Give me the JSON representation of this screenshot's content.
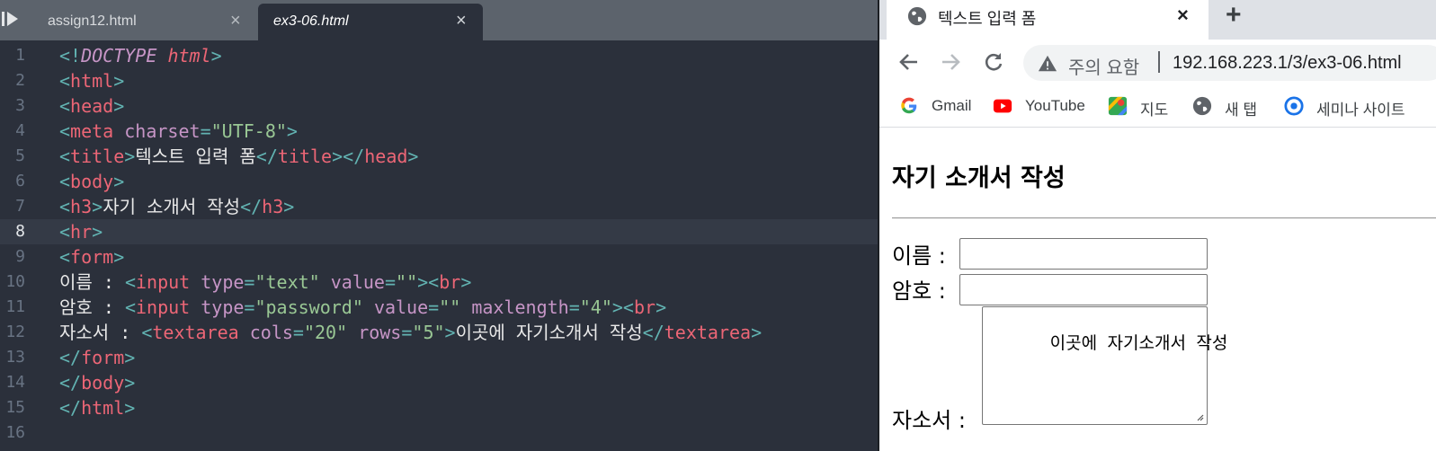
{
  "editor": {
    "tabs": [
      {
        "label": "assign12.html",
        "active": false
      },
      {
        "label": "ex3-06.html",
        "active": true
      }
    ],
    "close_glyph": "×",
    "current_line": 8,
    "line_numbers": [
      "1",
      "2",
      "3",
      "4",
      "5",
      "6",
      "7",
      "8",
      "9",
      "10",
      "11",
      "12",
      "13",
      "14",
      "15",
      "16"
    ],
    "lines": [
      [
        {
          "c": "p",
          "v": "<!"
        },
        {
          "c": "dk",
          "v": "DOCTYPE"
        },
        {
          "c": "tx",
          "v": " "
        },
        {
          "c": "dh",
          "v": "html"
        },
        {
          "c": "p",
          "v": ">"
        }
      ],
      [
        {
          "c": "p",
          "v": "<"
        },
        {
          "c": "t",
          "v": "html"
        },
        {
          "c": "p",
          "v": ">"
        }
      ],
      [
        {
          "c": "p",
          "v": "<"
        },
        {
          "c": "t",
          "v": "head"
        },
        {
          "c": "p",
          "v": ">"
        }
      ],
      [
        {
          "c": "p",
          "v": "<"
        },
        {
          "c": "t",
          "v": "meta"
        },
        {
          "c": "tx",
          "v": " "
        },
        {
          "c": "a",
          "v": "charset"
        },
        {
          "c": "p",
          "v": "="
        },
        {
          "c": "s",
          "v": "\"UTF-8\""
        },
        {
          "c": "p",
          "v": ">"
        }
      ],
      [
        {
          "c": "p",
          "v": "<"
        },
        {
          "c": "t",
          "v": "title"
        },
        {
          "c": "p",
          "v": ">"
        },
        {
          "c": "tx",
          "v": "텍스트 입력 폼"
        },
        {
          "c": "p",
          "v": "</"
        },
        {
          "c": "t",
          "v": "title"
        },
        {
          "c": "p",
          "v": "></"
        },
        {
          "c": "t",
          "v": "head"
        },
        {
          "c": "p",
          "v": ">"
        }
      ],
      [
        {
          "c": "p",
          "v": "<"
        },
        {
          "c": "t",
          "v": "body"
        },
        {
          "c": "p",
          "v": ">"
        }
      ],
      [
        {
          "c": "p",
          "v": "<"
        },
        {
          "c": "t",
          "v": "h3"
        },
        {
          "c": "p",
          "v": ">"
        },
        {
          "c": "tx",
          "v": "자기 소개서 작성"
        },
        {
          "c": "p",
          "v": "</"
        },
        {
          "c": "t",
          "v": "h3"
        },
        {
          "c": "p",
          "v": ">"
        }
      ],
      [
        {
          "c": "p",
          "v": "<"
        },
        {
          "c": "t",
          "v": "hr"
        },
        {
          "c": "p",
          "v": ">"
        }
      ],
      [
        {
          "c": "p",
          "v": "<"
        },
        {
          "c": "t",
          "v": "form"
        },
        {
          "c": "p",
          "v": ">"
        }
      ],
      [
        {
          "c": "tx",
          "v": "이름 : "
        },
        {
          "c": "p",
          "v": "<"
        },
        {
          "c": "t",
          "v": "input"
        },
        {
          "c": "tx",
          "v": " "
        },
        {
          "c": "a",
          "v": "type"
        },
        {
          "c": "p",
          "v": "="
        },
        {
          "c": "s",
          "v": "\"text\""
        },
        {
          "c": "tx",
          "v": " "
        },
        {
          "c": "a",
          "v": "value"
        },
        {
          "c": "p",
          "v": "="
        },
        {
          "c": "s",
          "v": "\"\""
        },
        {
          "c": "p",
          "v": "><"
        },
        {
          "c": "t",
          "v": "br"
        },
        {
          "c": "p",
          "v": ">"
        }
      ],
      [
        {
          "c": "tx",
          "v": "암호 : "
        },
        {
          "c": "p",
          "v": "<"
        },
        {
          "c": "t",
          "v": "input"
        },
        {
          "c": "tx",
          "v": " "
        },
        {
          "c": "a",
          "v": "type"
        },
        {
          "c": "p",
          "v": "="
        },
        {
          "c": "s",
          "v": "\"password\""
        },
        {
          "c": "tx",
          "v": " "
        },
        {
          "c": "a",
          "v": "value"
        },
        {
          "c": "p",
          "v": "="
        },
        {
          "c": "s",
          "v": "\"\""
        },
        {
          "c": "tx",
          "v": " "
        },
        {
          "c": "a",
          "v": "maxlength"
        },
        {
          "c": "p",
          "v": "="
        },
        {
          "c": "s",
          "v": "\"4\""
        },
        {
          "c": "p",
          "v": "><"
        },
        {
          "c": "t",
          "v": "br"
        },
        {
          "c": "p",
          "v": ">"
        }
      ],
      [
        {
          "c": "tx",
          "v": "자소서 : "
        },
        {
          "c": "p",
          "v": "<"
        },
        {
          "c": "t",
          "v": "textarea"
        },
        {
          "c": "tx",
          "v": " "
        },
        {
          "c": "a",
          "v": "cols"
        },
        {
          "c": "p",
          "v": "="
        },
        {
          "c": "s",
          "v": "\"20\""
        },
        {
          "c": "tx",
          "v": " "
        },
        {
          "c": "a",
          "v": "rows"
        },
        {
          "c": "p",
          "v": "="
        },
        {
          "c": "s",
          "v": "\"5\""
        },
        {
          "c": "p",
          "v": ">"
        },
        {
          "c": "tx",
          "v": "이곳에 자기소개서 작성"
        },
        {
          "c": "p",
          "v": "</"
        },
        {
          "c": "t",
          "v": "textarea"
        },
        {
          "c": "p",
          "v": ">"
        }
      ],
      [
        {
          "c": "p",
          "v": "</"
        },
        {
          "c": "t",
          "v": "form"
        },
        {
          "c": "p",
          "v": ">"
        }
      ],
      [
        {
          "c": "p",
          "v": "</"
        },
        {
          "c": "t",
          "v": "body"
        },
        {
          "c": "p",
          "v": ">"
        }
      ],
      [
        {
          "c": "p",
          "v": "</"
        },
        {
          "c": "t",
          "v": "html"
        },
        {
          "c": "p",
          "v": ">"
        }
      ],
      []
    ]
  },
  "browser": {
    "tab_title": "텍스트 입력 폼",
    "tab_close": "×",
    "new_tab": "+",
    "security_warning": "주의 요함",
    "url": "192.168.223.1/3/ex3-06.html",
    "bookmarks": [
      {
        "label": "Gmail",
        "icon": "google-g-icon"
      },
      {
        "label": "YouTube",
        "icon": "youtube-icon"
      },
      {
        "label": "지도",
        "icon": "maps-pin-icon"
      },
      {
        "label": "새 탭",
        "icon": "globe-icon"
      },
      {
        "label": "세미나 사이트",
        "icon": "target-icon"
      }
    ],
    "page": {
      "heading": "자기 소개서 작성",
      "name_label": "이름 :",
      "password_label": "암호 :",
      "intro_label": "자소서 :",
      "textarea_value": "이곳에 자기소개서 작성"
    }
  },
  "colors": {
    "editor_bg": "#2b303b",
    "tabbar_bg": "#5c636c",
    "tag": "#ec6676",
    "punct": "#62b3b2",
    "attr": "#c695c6",
    "string": "#99c794",
    "text": "#e8e8e8"
  }
}
